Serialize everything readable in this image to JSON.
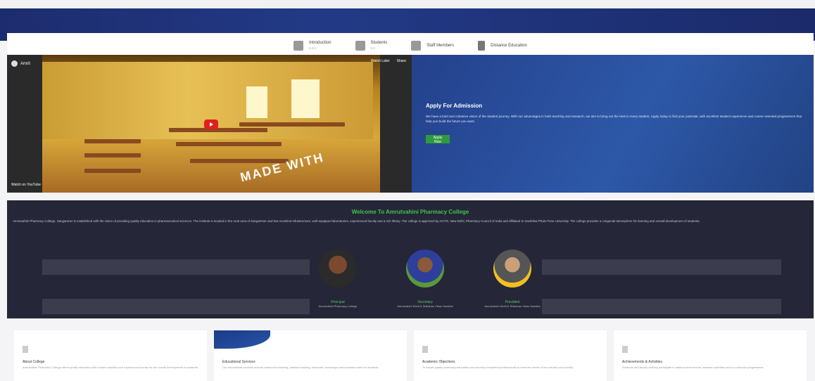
{
  "nav": {
    "items": [
      {
        "label": "Introduction",
        "sub": "x.x.x"
      },
      {
        "label": "Students",
        "sub": "x.x"
      },
      {
        "label": "Staff Members",
        "sub": ""
      },
      {
        "label": "Distance Education",
        "sub": ""
      }
    ]
  },
  "video": {
    "channel": "Amrit",
    "watch_later": "Watch Later",
    "share": "Share",
    "watch_on": "Watch on YouTube",
    "watermark": "MADE WITH"
  },
  "apply": {
    "title": "Apply For Admission",
    "text": "We have a bold and cohesive vision of the student journey. With our advantages in both teaching and research, we aim to bring out the best in every student. Apply today to find your potential, with excellent student experience and career-oriented programmes that help you build the future you want.",
    "button": "Apply Now"
  },
  "welcome": {
    "title": "Welcome To Amrutvahini Pharmacy College",
    "text": "Amrutvahini Pharmacy College, Sangamner is established with the vision of providing quality education in pharmaceutical sciences. The institute is located in the rural area of Sangamner and has excellent infrastructure, well-equipped laboratories, experienced faculty and a rich library. The college is approved by AICTE, New Delhi, Pharmacy Council of India and affiliated to Savitribai Phule Pune University. The college provides a congenial atmosphere for learning and overall development of students."
  },
  "people": [
    {
      "name": "Principal",
      "role": "Amrutvahini Pharmacy College"
    },
    {
      "name": "Secretary",
      "role": "Amrutvahini Sheti & Shikshan Vikas Sanstha"
    },
    {
      "name": "President",
      "role": "Amrutvahini Sheti & Shikshan Vikas Sanstha"
    }
  ],
  "cards": [
    {
      "title": "About College",
      "desc": "Amrutvahini Pharmacy College offers quality education with modern facilities and experienced faculty for the overall development of students."
    },
    {
      "title": "Educational Services",
      "desc": "Our educational services include classroom teaching, practical training, seminars, workshops and industrial visits for students."
    },
    {
      "title": "Academic Objectives",
      "desc": "To impart quality pharmacy education and develop competent professionals to meet the needs of the industry and society."
    },
    {
      "title": "Achievements & Activities",
      "desc": "Students and faculty actively participate in national level events, research activities and co-curricular programmes."
    }
  ]
}
